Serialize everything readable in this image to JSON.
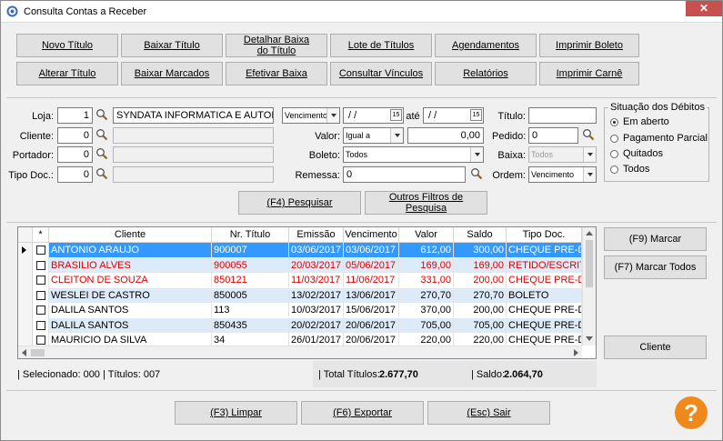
{
  "window": {
    "title": "Consulta Contas a Receber",
    "close": "✕"
  },
  "toolbar": {
    "row1": [
      "Novo Título",
      "Baixar Título",
      "Detalhar Baixa do Título",
      "Lote de Títulos",
      "Agendamentos",
      "Imprimir Boleto"
    ],
    "row2": [
      "Alterar Título",
      "Baixar Marcados",
      "Efetivar Baixa",
      "Consultar Vínculos",
      "Relatórios",
      "Imprimir Carnê"
    ]
  },
  "filters": {
    "loja": {
      "label": "Loja:",
      "code": "1",
      "name": "SYNDATA INFORMATICA E AUTOMAC"
    },
    "cliente": {
      "label": "Cliente:",
      "code": "0",
      "name": ""
    },
    "portador": {
      "label": "Portador:",
      "code": "0",
      "name": ""
    },
    "tipo_doc": {
      "label": "Tipo Doc.:",
      "code": "0",
      "name": ""
    },
    "date_type": "Vencimento",
    "date_from": "/ /",
    "date_to": "/ /",
    "ate": "até",
    "cal_from": "15",
    "cal_to": "15",
    "valor": {
      "label": "Valor:",
      "op": "Igual a",
      "value": "0,00"
    },
    "boleto": {
      "label": "Boleto:",
      "value": "Todos"
    },
    "remessa": {
      "label": "Remessa:",
      "value": "0"
    },
    "titulo": {
      "label": "Título:",
      "value": ""
    },
    "pedido": {
      "label": "Pedido:",
      "value": "0"
    },
    "baixa": {
      "label": "Baixa:",
      "value": "Todos"
    },
    "ordem": {
      "label": "Ordem:",
      "value": "Vencimento"
    }
  },
  "situacao": {
    "title": "Situação dos Débitos",
    "options": [
      "Em aberto",
      "Pagamento Parcial",
      "Quitados",
      "Todos"
    ],
    "selected": 0
  },
  "actions": {
    "pesquisar": "(F4) Pesquisar",
    "outros": "Outros Filtros de Pesquisa"
  },
  "grid": {
    "headers": [
      "*",
      "Cliente",
      "Nr. Título",
      "Emissão",
      "Vencimento",
      "Valor",
      "Saldo",
      "Tipo Doc."
    ],
    "rows": [
      {
        "cliente": "ANTONIO ARAUJO",
        "nr": "900007",
        "emissao": "03/06/2017",
        "venc": "03/06/2017",
        "valor": "612,00",
        "saldo": "300,00",
        "tipo": "CHEQUE PRE-DAT",
        "style": "selected"
      },
      {
        "cliente": "BRASILIO ALVES",
        "nr": "900055",
        "emissao": "20/03/2017",
        "venc": "05/06/2017",
        "valor": "169,00",
        "saldo": "169,00",
        "tipo": "RETIDO/ESCRITO",
        "style": "red-alt"
      },
      {
        "cliente": "CLEITON DE SOUZA",
        "nr": "850121",
        "emissao": "11/03/2017",
        "venc": "11/06/2017",
        "valor": "331,00",
        "saldo": "200,00",
        "tipo": "CHEQUE PRE-DAT",
        "style": "red"
      },
      {
        "cliente": "WESLEI DE CASTRO",
        "nr": "850005",
        "emissao": "13/02/2017",
        "venc": "13/06/2017",
        "valor": "270,70",
        "saldo": "270,70",
        "tipo": "BOLETO",
        "style": "alt"
      },
      {
        "cliente": "DALILA SANTOS",
        "nr": "113",
        "emissao": "10/03/2017",
        "venc": "15/06/2017",
        "valor": "370,00",
        "saldo": "200,00",
        "tipo": "CHEQUE PRE-DAT",
        "style": "normal"
      },
      {
        "cliente": "DALILA SANTOS",
        "nr": "850435",
        "emissao": "20/02/2017",
        "venc": "20/06/2017",
        "valor": "705,00",
        "saldo": "705,00",
        "tipo": "CHEQUE PRE-DAT",
        "style": "alt"
      },
      {
        "cliente": "MAURICIO DA SILVA",
        "nr": "34",
        "emissao": "26/01/2017",
        "venc": "20/06/2017",
        "valor": "220,00",
        "saldo": "220,00",
        "tipo": "CHEQUE PRE-DAT",
        "style": "normal"
      }
    ]
  },
  "side_buttons": {
    "marcar": "(F9) Marcar",
    "marcar_todos": "(F7) Marcar Todos",
    "cliente": "Cliente"
  },
  "status": {
    "selecionado": "| Selecionado: 000 | Títulos: 007",
    "total_label": "| Total Títulos:",
    "total": "2.677,70",
    "saldo_label": "| Saldo:",
    "saldo": "2.064,70"
  },
  "bottom": {
    "limpar": "(F3) Limpar",
    "exportar": "(F6) Exportar",
    "sair": "(Esc) Sair"
  },
  "help": "?"
}
